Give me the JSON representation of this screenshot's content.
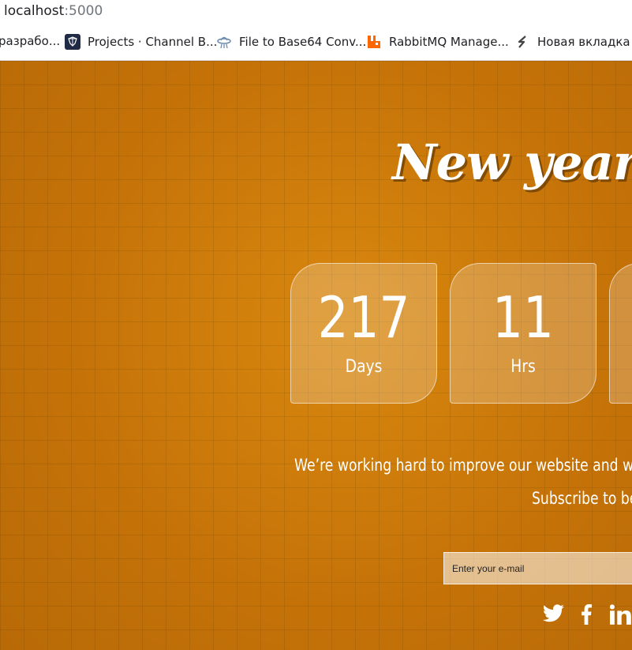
{
  "browser": {
    "url_host": "localhost",
    "url_port": ":5000",
    "bookmarks": [
      {
        "label": "разрабо...",
        "icon": "folder-icon"
      },
      {
        "label": "Projects · Channel B...",
        "icon": "channel-logo-icon"
      },
      {
        "label": "File to Base64 Conv...",
        "icon": "ufo-icon"
      },
      {
        "label": "RabbitMQ Manage...",
        "icon": "rabbitmq-icon"
      },
      {
        "label": "Новая вкладка",
        "icon": "s-icon"
      }
    ]
  },
  "page": {
    "title": "New year co",
    "countdown": [
      {
        "value": "217",
        "unit": "Days"
      },
      {
        "value": "11",
        "unit": "Hrs"
      }
    ],
    "message": "We’re working hard to improve our website and we’ll bac",
    "subscribe_text": "Subscribe to be n",
    "email_placeholder": "Enter your e-mail",
    "social": [
      "twitter-icon",
      "facebook-icon",
      "linkedin-icon"
    ],
    "colors": {
      "background": "#c9760a",
      "text": "#ffffff"
    }
  }
}
